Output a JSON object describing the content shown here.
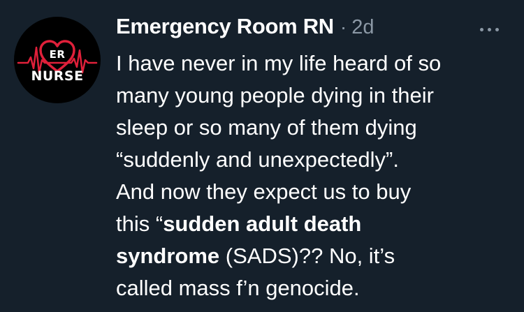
{
  "avatar": {
    "icon": "er-nurse-heart-ekg-logo",
    "text_top": "ER",
    "text_bottom": "NURSE",
    "colors": {
      "background": "#000000",
      "heart": "#e0203a",
      "ekg": "#e0203a"
    }
  },
  "header": {
    "display_name": "Emergency Room RN",
    "separator": "·",
    "timestamp": "2d"
  },
  "more_button": {
    "icon": "more-horizontal-icon"
  },
  "tweet": {
    "lines": [
      [
        {
          "text": "I have never in my life heard of so",
          "bold": false
        }
      ],
      [
        {
          "text": "many young people dying in their",
          "bold": false
        }
      ],
      [
        {
          "text": "sleep or so many of them dying",
          "bold": false
        }
      ],
      [
        {
          "text": "“suddenly and unexpectedly”.",
          "bold": false
        }
      ],
      [
        {
          "text": "And now they expect us to buy",
          "bold": false
        }
      ],
      [
        {
          "text": "this “",
          "bold": false
        },
        {
          "text": "sudden adult death",
          "bold": true
        }
      ],
      [
        {
          "text": "syndrome",
          "bold": true
        },
        {
          "text": " (SADS)?? No, it’s",
          "bold": false
        }
      ],
      [
        {
          "text": "called mass f’n genocide.",
          "bold": false
        }
      ]
    ]
  },
  "colors": {
    "background": "#15202b",
    "text_primary": "#ffffff",
    "text_secondary": "#8b98a5"
  }
}
